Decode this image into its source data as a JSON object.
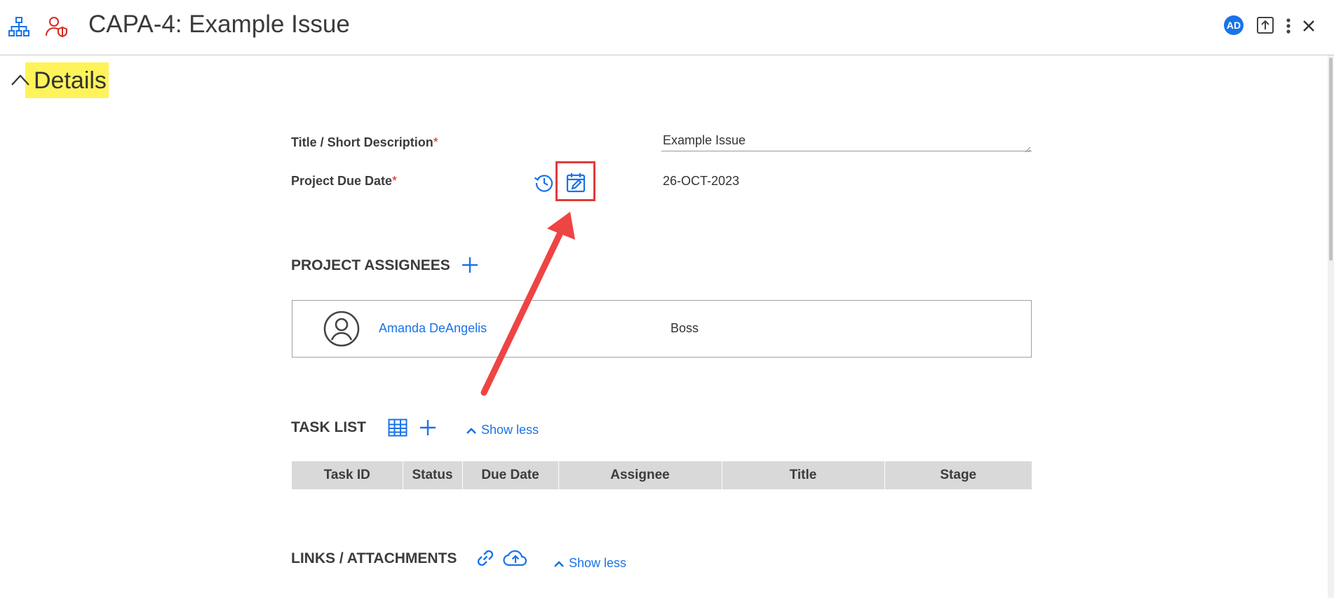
{
  "header": {
    "title": "CAPA-4: Example Issue",
    "avatar_initials": "AD",
    "icons": [
      "hierarchy-icon",
      "user-shield-icon",
      "upload-icon",
      "more-vertical-icon",
      "close-icon"
    ]
  },
  "details": {
    "heading": "Details",
    "title_field": {
      "label": "Title / Short Description",
      "required_mark": "*",
      "value": "Example Issue"
    },
    "due_date_field": {
      "label": "Project Due Date",
      "required_mark": "*",
      "value": "26-OCT-2023"
    }
  },
  "assignees": {
    "heading": "PROJECT ASSIGNEES",
    "items": [
      {
        "name": "Amanda DeAngelis",
        "role": "Boss"
      }
    ]
  },
  "task_list": {
    "heading": "TASK LIST",
    "toggle_label": "Show less",
    "columns": [
      "Task ID",
      "Status",
      "Due Date",
      "Assignee",
      "Title",
      "Stage"
    ]
  },
  "links": {
    "heading": "LINKS / ATTACHMENTS",
    "toggle_label": "Show less"
  },
  "colors": {
    "accent": "#1a73e8",
    "highlight": "#fff35a",
    "annotation": "#e03b3b",
    "required": "#d9281d"
  }
}
